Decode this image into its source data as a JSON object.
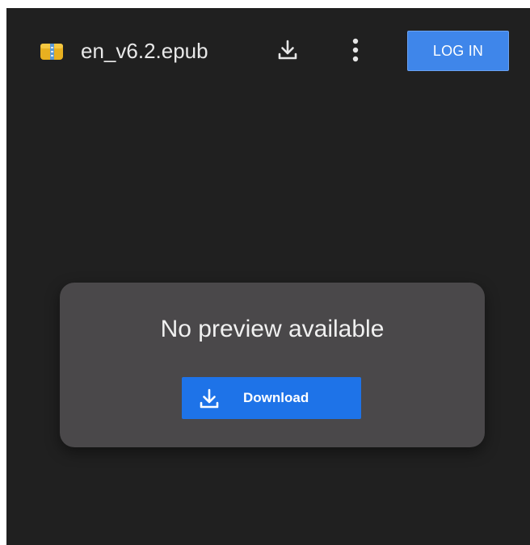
{
  "header": {
    "file_name": "en_v6.2.epub",
    "file_icon": "archive-file-icon",
    "download_icon": "download-icon",
    "more_icon": "more-vert-icon",
    "login_label": "LOG IN"
  },
  "preview": {
    "message": "No preview available",
    "download_label": "Download",
    "download_icon": "download-icon"
  },
  "colors": {
    "background": "#202020",
    "card": "#4a484a",
    "accent": "#1e73e8",
    "login": "#3f86ea"
  }
}
